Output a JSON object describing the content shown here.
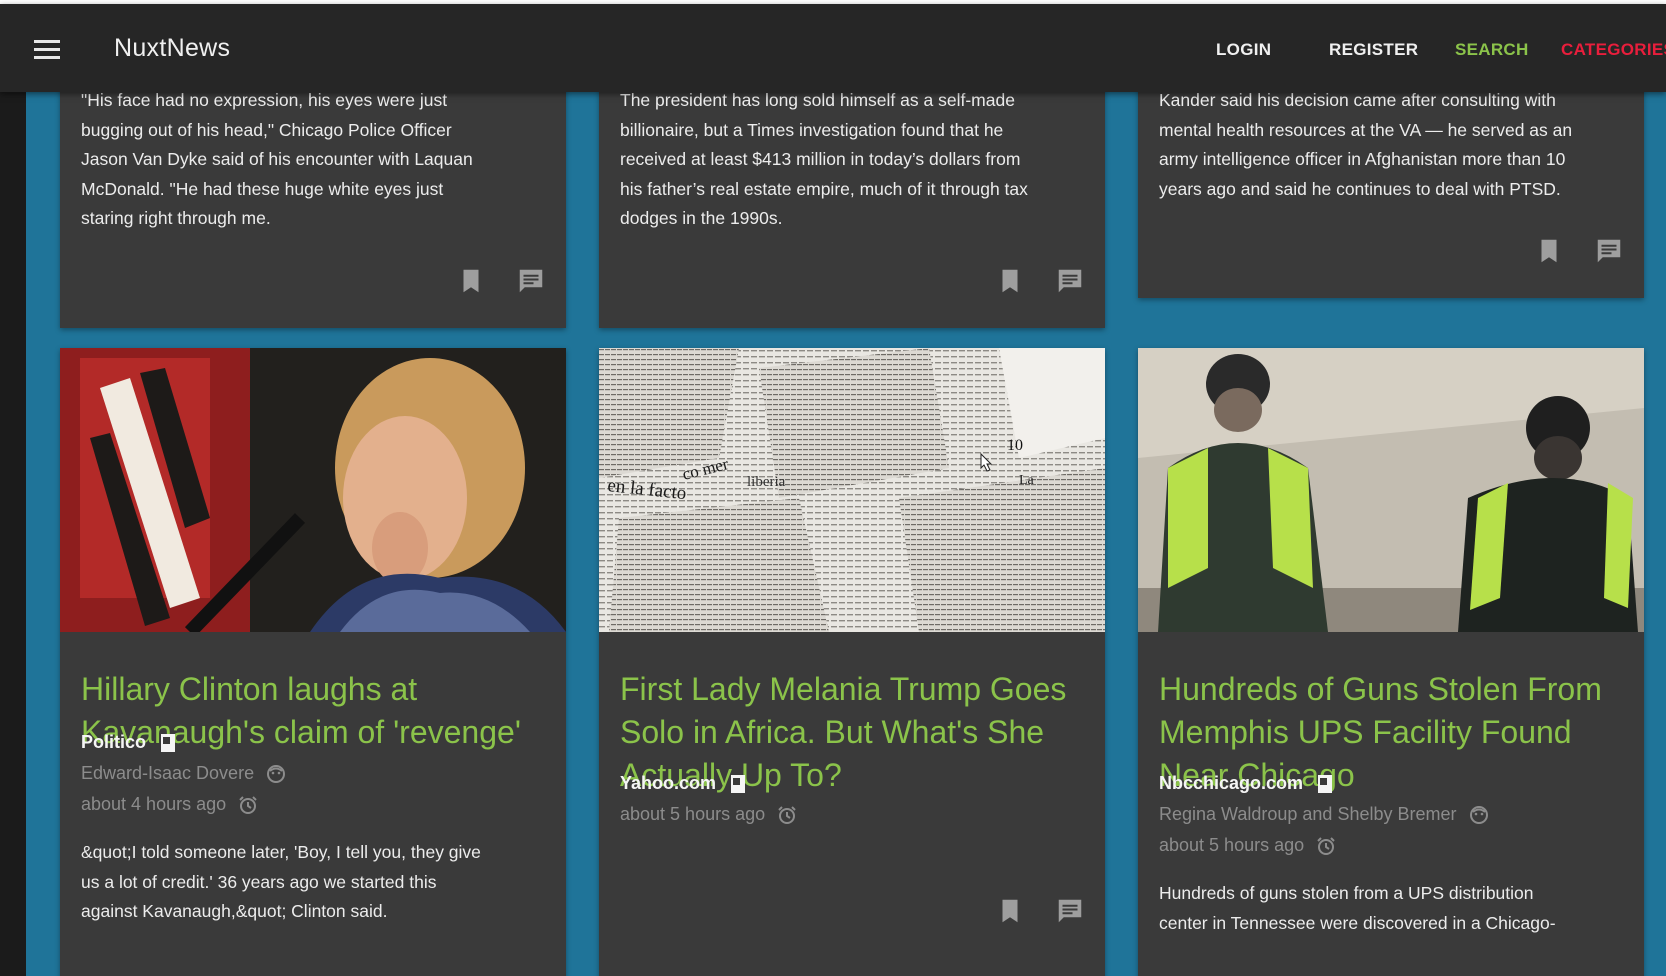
{
  "app": {
    "title": "NuxtNews",
    "nav": {
      "login": "LOGIN",
      "register": "REGISTER",
      "search": "SEARCH",
      "categories": "CATEGORIES"
    }
  },
  "colors": {
    "appbar": "#262626",
    "background": "#1f7499",
    "card": "#3a3a3a",
    "title_green": "#8bc34a",
    "categories_red": "#e91e3c"
  },
  "top_cards": [
    {
      "excerpt_lines": [
        "\"His face had no expression, his eyes were just",
        "bugging out of his head,\" Chicago Police Officer",
        "Jason Van Dyke said of his encounter with Laquan",
        "McDonald. \"He had these huge white eyes just",
        "staring right through me."
      ],
      "actions": [
        "bookmark-icon",
        "comment-icon"
      ]
    },
    {
      "excerpt_lines": [
        "The president has long sold himself as a self-made",
        "billionaire, but a Times investigation found that he",
        "received at least $413 million in today’s dollars from",
        "his father’s real estate empire, much of it through tax",
        "dodges in the 1990s."
      ],
      "actions": [
        "bookmark-icon",
        "comment-icon"
      ]
    },
    {
      "excerpt_lines": [
        "Kander said his decision came after consulting with",
        "mental health resources at the VA — he served as an",
        "army intelligence officer in Afghanistan more than 10",
        "years ago and said he continues to deal with PTSD."
      ],
      "actions": [
        "bookmark-icon",
        "comment-icon"
      ]
    }
  ],
  "articles": [
    {
      "title": "Hillary Clinton laughs at Kavanaugh's claim of 'revenge'",
      "source": "Politico",
      "author": "Edward-Isaac Dovere",
      "time": "about 4 hours ago",
      "excerpt_lines": [
        "&quot;I told someone later, 'Boy, I tell you, they give",
        "us a lot of credit.' 36 years ago we started this",
        "against Kavanaugh,&quot; Clinton said."
      ],
      "image": "photo-woman-speaking"
    },
    {
      "title": "First Lady Melania Trump Goes Solo in Africa. But What's She Actually Up To?",
      "source": "Yahoo.com",
      "time": "about 5 hours ago",
      "image": "newspaper-collage",
      "image_words": [
        "en la facto",
        "co mer",
        "liberia",
        "10",
        "La"
      ]
    },
    {
      "title": "Hundreds of Guns Stolen From Memphis UPS Facility Found Near Chicago",
      "source": "Nbcchicago.com",
      "author": "Regina Waldroup and Shelby Bremer",
      "time": "about 5 hours ago",
      "excerpt_lines": [
        "Hundreds of guns stolen from a UPS distribution",
        "center in Tennessee were discovered in a Chicago-"
      ],
      "image": "surveillance-two-men-vests"
    }
  ]
}
